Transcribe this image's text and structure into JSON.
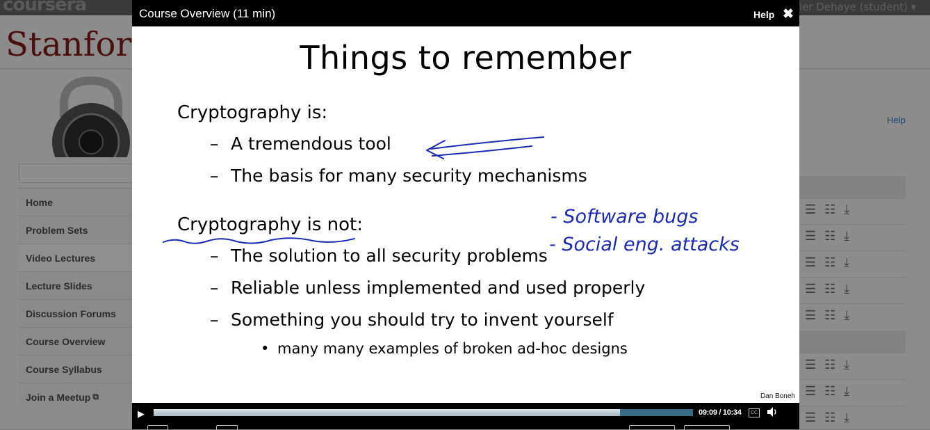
{
  "background": {
    "logo": "coursera",
    "user_menu": "vier Dehaye (student)",
    "institution": "Stanford",
    "help_link": "Help",
    "nav_items": [
      {
        "label": "Home"
      },
      {
        "label": "Problem Sets"
      },
      {
        "label": "Video Lectures"
      },
      {
        "label": "Lecture Slides"
      },
      {
        "label": "Discussion Forums"
      },
      {
        "label": "Course Overview"
      },
      {
        "label": "Course Syllabus"
      },
      {
        "label": "Join a Meetup"
      }
    ]
  },
  "modal": {
    "title": "Course Overview (11 min)",
    "help_label": "Help",
    "close_icon": "close-icon"
  },
  "slide": {
    "title": "Things to remember",
    "heading_is": "Cryptography is:",
    "is_items": [
      "A tremendous tool",
      "The basis for many security mechanisms"
    ],
    "heading_not": "Cryptography is not:",
    "not_items": [
      "The solution to all security problems",
      "Reliable unless implemented and used properly",
      "Something you should try to invent yourself"
    ],
    "sub_item": "many many examples of broken ad-hoc designs",
    "author": "Dan Boneh",
    "handwriting": [
      "- Software bugs",
      "- Social eng. attacks"
    ]
  },
  "player": {
    "current_time": "09:09",
    "duration": "10:34",
    "time_display": "09:09 / 10:34",
    "progress_fraction": 0.865,
    "buffered_fraction": 1.0,
    "cc_label": "CC",
    "colors": {
      "ink": "#1a2bb0",
      "progress_bar": "#2c4f63"
    }
  }
}
